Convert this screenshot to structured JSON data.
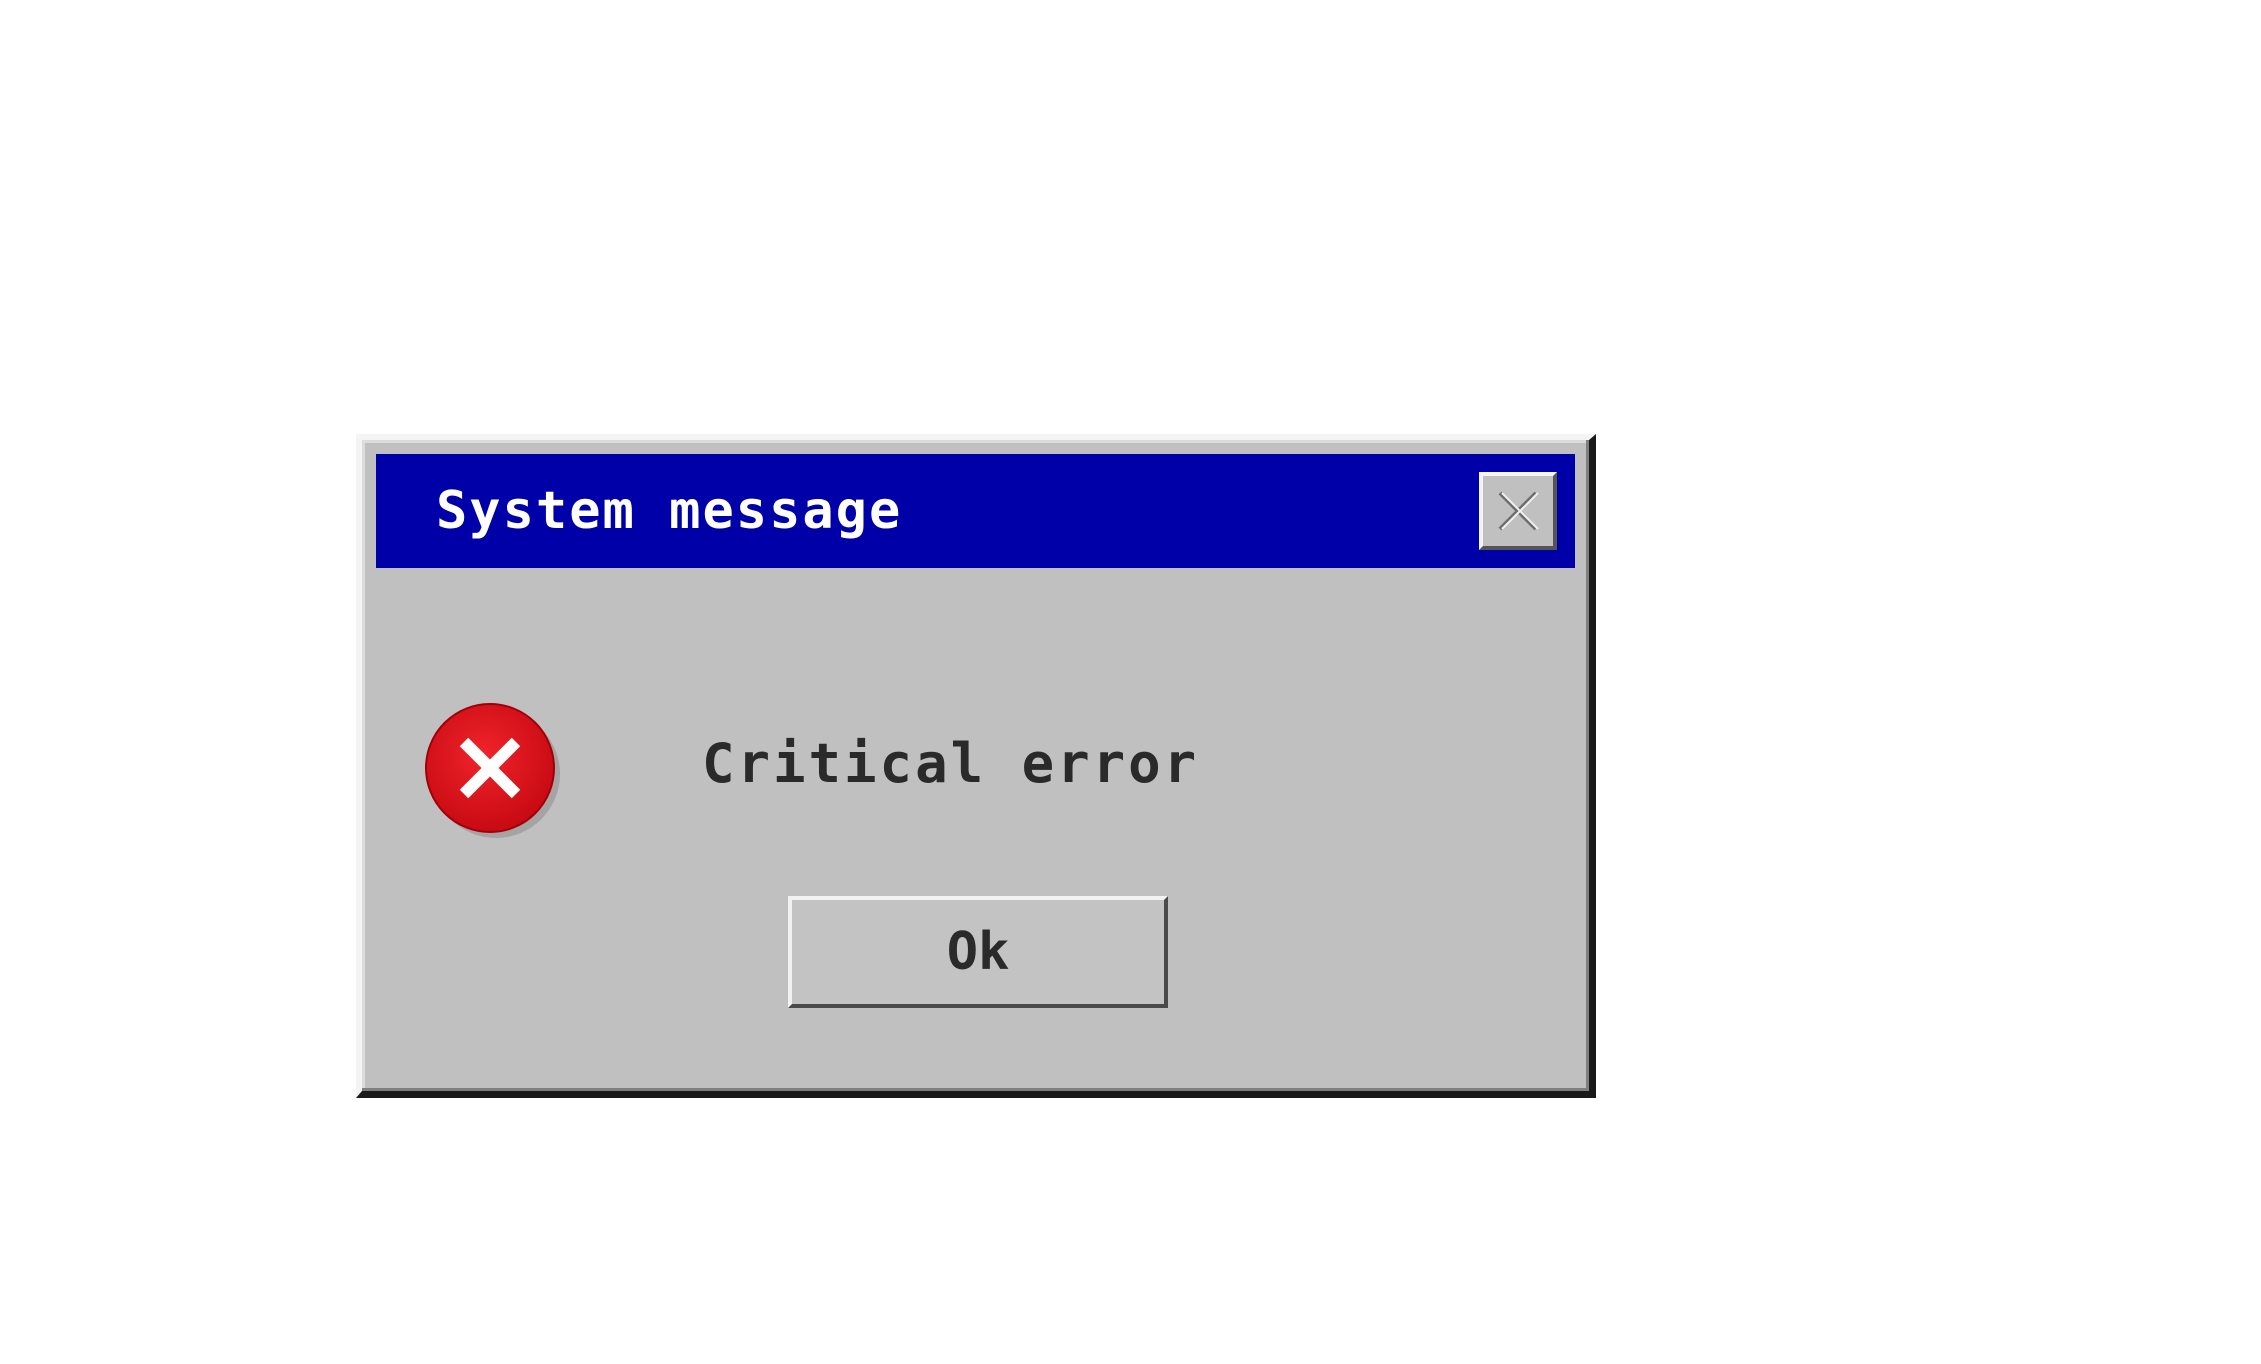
{
  "dialog": {
    "title": "System message",
    "message": "Critical error",
    "ok_label": "Ok",
    "icons": {
      "close": "close-icon",
      "error": "error-icon"
    }
  },
  "colors": {
    "titlebar": "#0000a8",
    "window": "#c0c0c0",
    "error_red": "#d90c16",
    "title_text": "#ffffff"
  }
}
